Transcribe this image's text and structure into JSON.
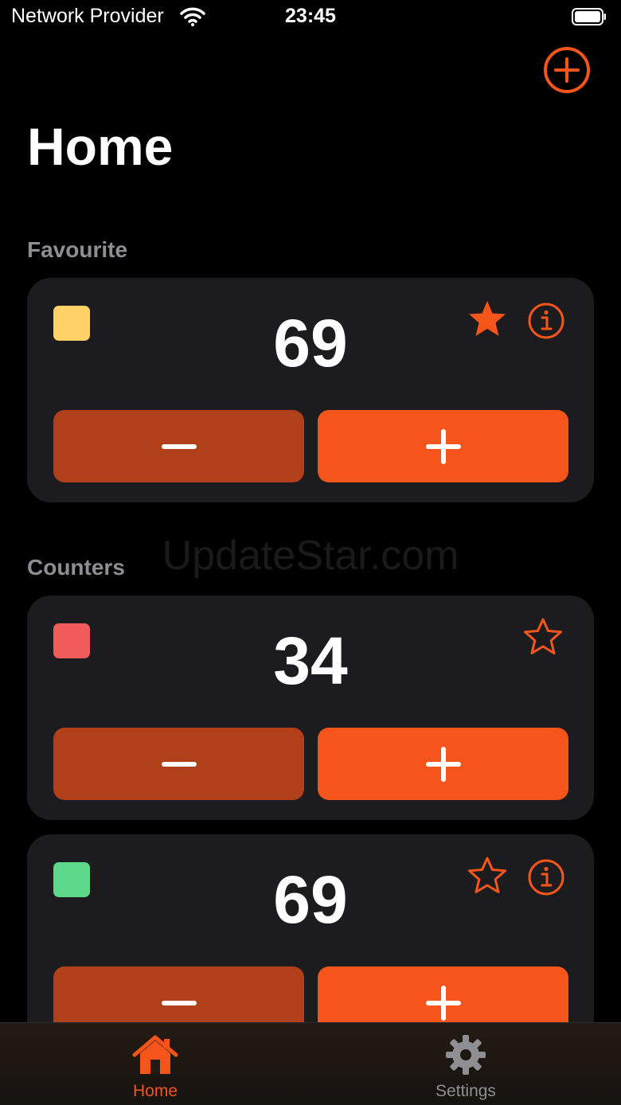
{
  "status_bar": {
    "carrier": "Network Provider",
    "time": "23:45"
  },
  "title": "Home",
  "sections": {
    "favourite": "Favourite",
    "counters": "Counters"
  },
  "cards": [
    {
      "value": "69",
      "swatch_color": "#ffd166",
      "favourite": true,
      "show_info": true
    },
    {
      "value": "34",
      "swatch_color": "#f15b5b",
      "favourite": false,
      "show_info": false
    },
    {
      "value": "69",
      "swatch_color": "#5dd88a",
      "favourite": false,
      "show_info": true
    }
  ],
  "tabs": {
    "home": "Home",
    "settings": "Settings"
  },
  "watermark": "UpdateStar.com",
  "colors": {
    "accent": "#f5541b",
    "accent_dark": "#b03f1a",
    "card": "#1c1c1e",
    "inactive": "#8e8e93"
  },
  "icons": [
    "wifi-icon",
    "battery-icon",
    "plus-circle-icon",
    "star-filled-icon",
    "star-outline-icon",
    "info-icon",
    "minus-icon",
    "plus-icon",
    "house-icon",
    "gear-icon"
  ]
}
